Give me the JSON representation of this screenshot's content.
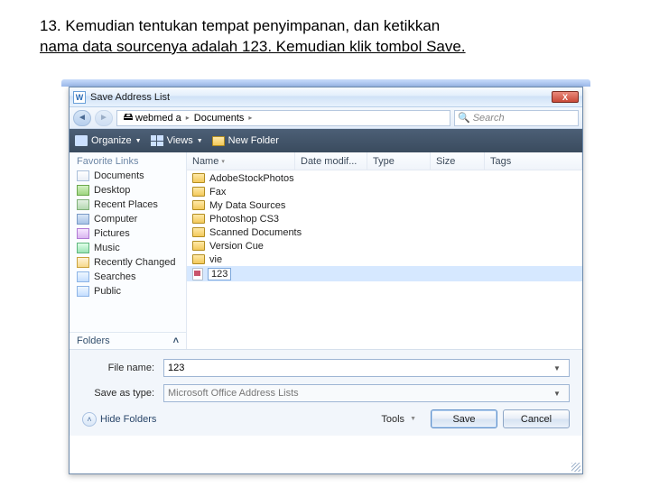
{
  "instruction": {
    "num": "13.",
    "line1_rest": "Kemudian tentukan tempat penyimpanan, dan ketikkan",
    "line2": "nama data sourcenya adalah 123. Kemudian klik tombol Save."
  },
  "dialog": {
    "title": "Save Address List",
    "word_glyph": "W",
    "close_glyph": "X",
    "breadcrumb": {
      "drive": "webmed a",
      "folder": "Documents",
      "sep": "▸"
    },
    "search_placeholder": "Search",
    "toolbar": {
      "organize": "Organize",
      "views": "Views",
      "new_folder": "New Folder"
    },
    "sidebar_header": "Favorite Links",
    "sidebar": [
      {
        "label": "Documents",
        "cls": "icn-doc"
      },
      {
        "label": "Desktop",
        "cls": "icn-desk"
      },
      {
        "label": "Recent Places",
        "cls": "icn-rp"
      },
      {
        "label": "Computer",
        "cls": "icn-comp"
      },
      {
        "label": "Pictures",
        "cls": "icn-pic"
      },
      {
        "label": "Music",
        "cls": "icn-mus"
      },
      {
        "label": "Recently Changed",
        "cls": "icn-rec"
      },
      {
        "label": "Searches",
        "cls": "icn-srch"
      },
      {
        "label": "Public",
        "cls": "icn-pub"
      }
    ],
    "folders_label": "Folders",
    "columns": {
      "name": "Name",
      "date": "Date modif...",
      "type": "Type",
      "size": "Size",
      "tags": "Tags"
    },
    "rows": [
      {
        "kind": "folder",
        "name": "AdobeStockPhotos"
      },
      {
        "kind": "folder",
        "name": "Fax"
      },
      {
        "kind": "folder",
        "name": "My Data Sources"
      },
      {
        "kind": "folder",
        "name": "Photoshop CS3"
      },
      {
        "kind": "folder",
        "name": "Scanned Documents"
      },
      {
        "kind": "folder",
        "name": "Version Cue"
      },
      {
        "kind": "folder",
        "name": "vie"
      },
      {
        "kind": "file",
        "name": "123",
        "selected": true
      }
    ],
    "filename_label": "File name:",
    "filename_value": "123",
    "savetype_label": "Save as type:",
    "savetype_value": "Microsoft Office Address Lists",
    "hide_folders": "Hide Folders",
    "tools": "Tools",
    "save": "Save",
    "cancel": "Cancel"
  }
}
